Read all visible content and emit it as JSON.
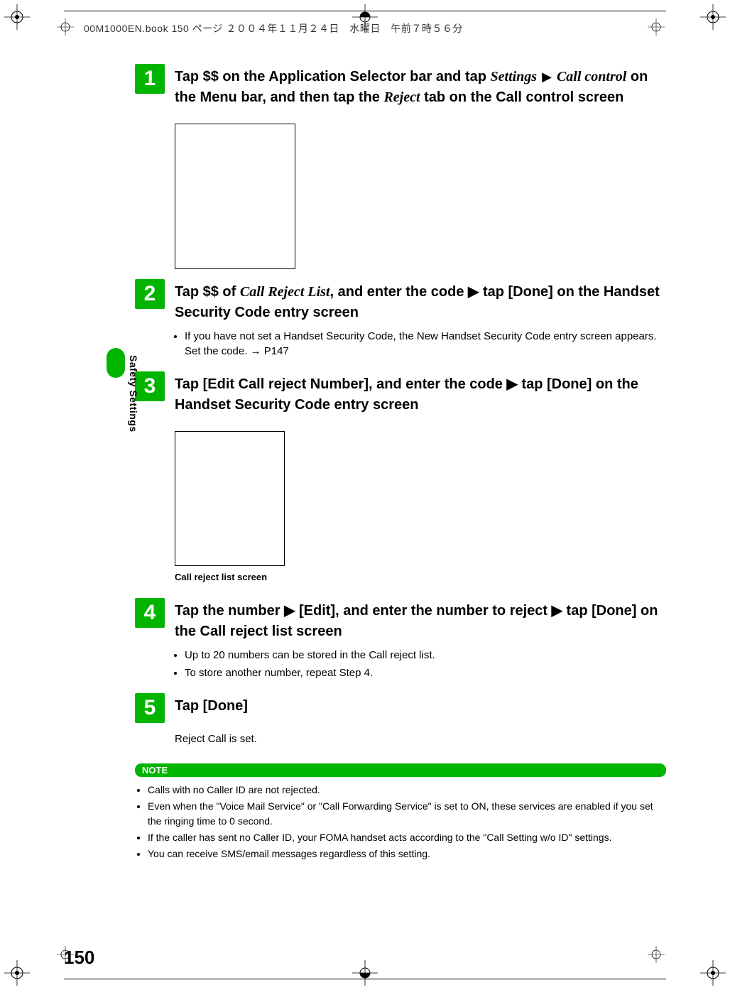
{
  "header": "00M1000EN.book  150 ページ  ２００４年１１月２４日　水曜日　午前７時５６分",
  "side_tab_label": "Safety Settings",
  "steps": [
    {
      "num": "1",
      "title_parts": [
        {
          "t": "Tap $$ on the Application Selector bar and tap ",
          "cls": ""
        },
        {
          "t": "Settings",
          "cls": "it"
        },
        {
          "t": " ▶ ",
          "cls": "arrow"
        },
        {
          "t": "Call control",
          "cls": "it"
        },
        {
          "t": " on the Menu bar, and then tap the ",
          "cls": ""
        },
        {
          "t": "Reject",
          "cls": "it"
        },
        {
          "t": " tab on the Call control screen",
          "cls": ""
        }
      ]
    },
    {
      "num": "2",
      "title_parts": [
        {
          "t": "Tap $$ of ",
          "cls": ""
        },
        {
          "t": "Call Reject List",
          "cls": "it"
        },
        {
          "t": ", and enter the code ▶ tap [Done] on the Handset Security Code entry screen",
          "cls": ""
        }
      ],
      "bullets": [
        "If you have not set a Handset Security Code, the New Handset Security Code entry screen appears. Set the code. → P147"
      ]
    },
    {
      "num": "3",
      "title_parts": [
        {
          "t": "Tap [Edit Call reject Number], and enter the code ▶ tap [Done] on the Handset Security Code entry screen",
          "cls": ""
        }
      ]
    },
    {
      "num": "4",
      "title_parts": [
        {
          "t": "Tap the number ▶ [Edit], and enter the number to reject ▶ tap [Done] on the Call reject list screen",
          "cls": ""
        }
      ],
      "bullets": [
        "Up to 20 numbers can be stored in the Call reject list.",
        "To store another number, repeat Step 4."
      ]
    },
    {
      "num": "5",
      "title_parts": [
        {
          "t": "Tap [Done]",
          "cls": ""
        }
      ],
      "subtext": "Reject Call is set."
    }
  ],
  "caption1": "Call reject list screen",
  "note_label": "NOTE",
  "notes": [
    "Calls with no Caller ID are not rejected.",
    "Even when the \"Voice Mail Service\" or \"Call Forwarding Service\" is set to ON, these services are enabled if you set the ringing time to 0 second.",
    "If the caller has sent no Caller ID, your FOMA handset acts according to the \"Call Setting w/o ID\" settings.",
    "You can receive SMS/email messages regardless of this setting."
  ],
  "page_number": "150"
}
